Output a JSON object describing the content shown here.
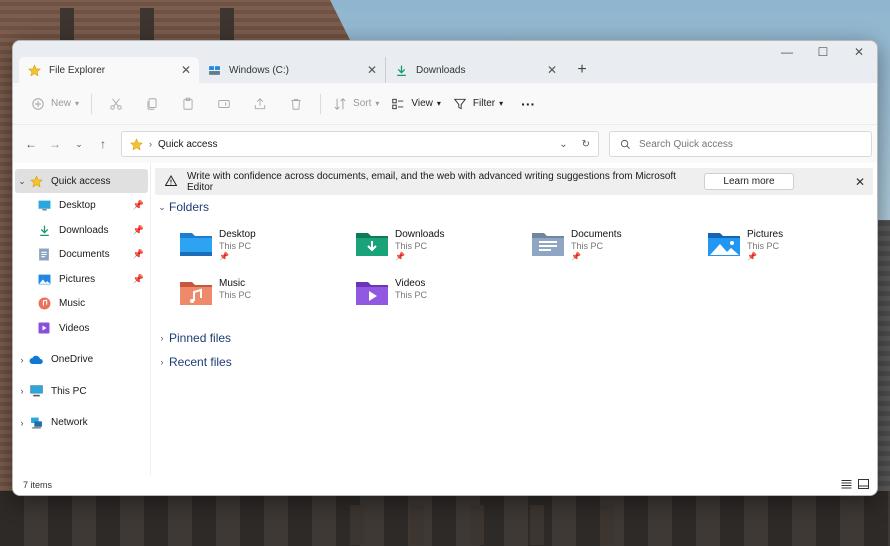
{
  "tabs": [
    {
      "label": "File Explorer",
      "icon": "star-icon",
      "active": true
    },
    {
      "label": "Windows (C:)",
      "icon": "drive-icon",
      "active": false
    },
    {
      "label": "Downloads",
      "icon": "download-icon",
      "active": false
    }
  ],
  "window_controls": {
    "minimize": "—",
    "maximize": "☐",
    "close": "✕"
  },
  "commandbar": {
    "new_label": "New",
    "sort_label": "Sort",
    "view_label": "View",
    "filter_label": "Filter",
    "more_label": "···"
  },
  "address": {
    "crumb": "Quick access",
    "search_placeholder": "Search Quick access"
  },
  "sidebar": {
    "quick_access": "Quick access",
    "pinned": [
      {
        "label": "Desktop",
        "icon": "desktop-icon"
      },
      {
        "label": "Downloads",
        "icon": "download-icon"
      },
      {
        "label": "Documents",
        "icon": "documents-icon"
      },
      {
        "label": "Pictures",
        "icon": "pictures-icon"
      },
      {
        "label": "Music",
        "icon": "music-icon"
      },
      {
        "label": "Videos",
        "icon": "videos-icon"
      }
    ],
    "roots": [
      {
        "label": "OneDrive",
        "icon": "cloud-icon"
      },
      {
        "label": "This PC",
        "icon": "pc-icon"
      },
      {
        "label": "Network",
        "icon": "network-icon"
      }
    ]
  },
  "infobar": {
    "message": "Write with confidence across documents, email, and the web with advanced writing suggestions from Microsoft Editor",
    "button": "Learn more"
  },
  "sections": {
    "folders": "Folders",
    "pinned_files": "Pinned files",
    "recent_files": "Recent files"
  },
  "folders": [
    {
      "name": "Desktop",
      "location": "This PC",
      "pinned": true
    },
    {
      "name": "Downloads",
      "location": "This PC",
      "pinned": true
    },
    {
      "name": "Documents",
      "location": "This PC",
      "pinned": true
    },
    {
      "name": "Pictures",
      "location": "This PC",
      "pinned": true
    },
    {
      "name": "Music",
      "location": "This PC",
      "pinned": false
    },
    {
      "name": "Videos",
      "location": "This PC",
      "pinned": false
    }
  ],
  "status": {
    "count": "7 items"
  },
  "colors": {
    "accent": "#0067c0",
    "folder_blue": "#1e88e5",
    "section_text": "#1e3c72"
  }
}
